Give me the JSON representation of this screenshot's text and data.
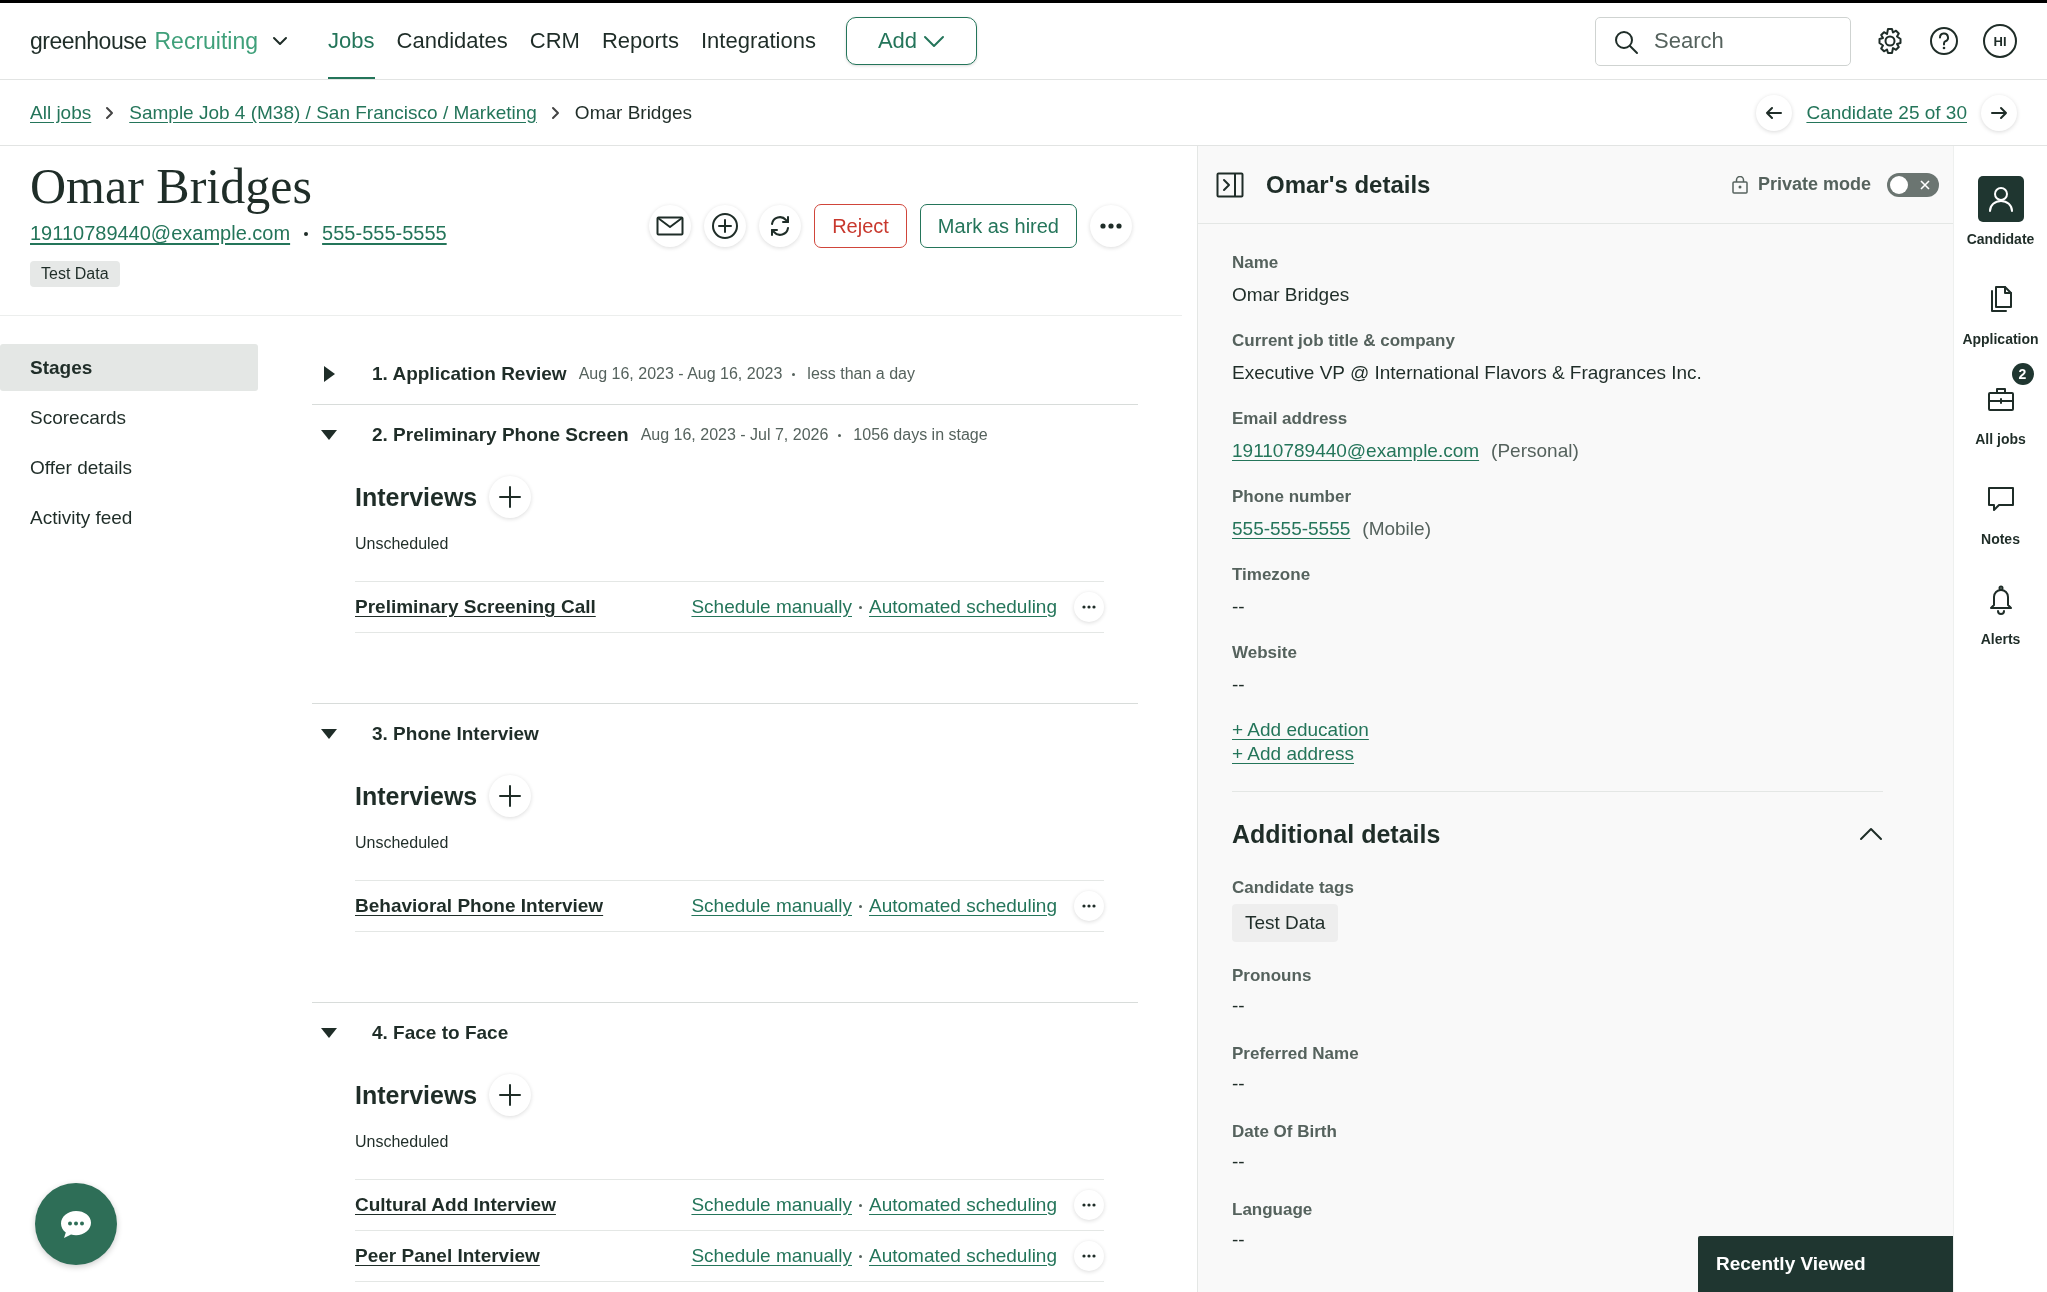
{
  "nav": {
    "logo": "greenhouse",
    "product": "Recruiting",
    "items": [
      {
        "label": "Jobs",
        "selected": true
      },
      {
        "label": "Candidates",
        "selected": false
      },
      {
        "label": "CRM",
        "selected": false
      },
      {
        "label": "Reports",
        "selected": false
      },
      {
        "label": "Integrations",
        "selected": false
      }
    ],
    "add_button": "Add",
    "search": {
      "placeholder": "Search"
    },
    "avatar": "HI"
  },
  "breadcrumb": {
    "items": [
      {
        "label": "All jobs",
        "kind": "link"
      },
      {
        "label": "Sample Job 4 (M38) / San Francisco / Marketing",
        "kind": "link"
      },
      {
        "label": "Omar Bridges",
        "kind": "current"
      }
    ],
    "pager": "Candidate 25 of 30"
  },
  "candidate": {
    "name": "Omar Bridges",
    "email": "19110789440@example.com",
    "phone": "555-555-5555",
    "tags": [
      "Test Data"
    ],
    "reject": "Reject",
    "hire": "Mark as hired"
  },
  "side_nav": [
    {
      "label": "Stages",
      "selected": true
    },
    {
      "label": "Scorecards",
      "selected": false
    },
    {
      "label": "Offer details",
      "selected": false
    },
    {
      "label": "Activity feed",
      "selected": false
    }
  ],
  "stages": [
    {
      "title": "1. Application Review",
      "dates": "Aug 16, 2023 - Aug 16, 2023",
      "duration": "less than a day",
      "expanded": false
    },
    {
      "title": "2. Preliminary Phone Screen",
      "dates": "Aug 16, 2023 - Jul 7, 2026",
      "duration": "1056 days in stage",
      "expanded": true,
      "heading": "Interviews",
      "status": "Unscheduled",
      "interviews": [
        {
          "name": "Preliminary Screening Call",
          "manual": "Schedule manually",
          "auto": "Automated scheduling"
        }
      ]
    },
    {
      "title": "3. Phone Interview",
      "expanded": true,
      "heading": "Interviews",
      "status": "Unscheduled",
      "interviews": [
        {
          "name": "Behavioral Phone Interview",
          "manual": "Schedule manually",
          "auto": "Automated scheduling"
        }
      ]
    },
    {
      "title": "4. Face to Face",
      "expanded": true,
      "heading": "Interviews",
      "status": "Unscheduled",
      "interviews": [
        {
          "name": "Cultural Add Interview",
          "manual": "Schedule manually",
          "auto": "Automated scheduling"
        },
        {
          "name": "Peer Panel Interview",
          "manual": "Schedule manually",
          "auto": "Automated scheduling"
        }
      ]
    }
  ],
  "details": {
    "title": "Omar's details",
    "private_mode": {
      "label": "Private mode",
      "on": false
    },
    "fields": [
      {
        "label": "Name",
        "kind": "text",
        "value": "Omar Bridges"
      },
      {
        "label": "Current job title & company",
        "kind": "text",
        "value": "Executive VP @ International Flavors & Fragrances Inc."
      },
      {
        "label": "Email address",
        "kind": "link",
        "value": "19110789440@example.com",
        "note": "(Personal)"
      },
      {
        "label": "Phone number",
        "kind": "link",
        "value": "555-555-5555",
        "note": "(Mobile)"
      },
      {
        "label": "Timezone",
        "kind": "text",
        "value": "--"
      },
      {
        "label": "Website",
        "kind": "text",
        "value": "--"
      }
    ],
    "add_links": [
      "+ Add education",
      "+ Add address"
    ],
    "additional": {
      "title": "Additional details",
      "expanded": true,
      "fields": [
        {
          "label": "Candidate tags",
          "kind": "tag",
          "value": "Test Data"
        },
        {
          "label": "Pronouns",
          "kind": "text",
          "value": "--"
        },
        {
          "label": "Preferred Name",
          "kind": "text",
          "value": "--"
        },
        {
          "label": "Date Of Birth",
          "kind": "text",
          "value": "--"
        },
        {
          "label": "Language",
          "kind": "text",
          "value": "--"
        }
      ]
    }
  },
  "rail": [
    {
      "label": "Candidate",
      "selected": true
    },
    {
      "label": "Application",
      "selected": false
    },
    {
      "label": "All jobs",
      "selected": false,
      "badge": "2"
    },
    {
      "label": "Notes",
      "selected": false
    },
    {
      "label": "Alerts",
      "selected": false
    }
  ],
  "recently_viewed": {
    "title": "Recently Viewed"
  }
}
